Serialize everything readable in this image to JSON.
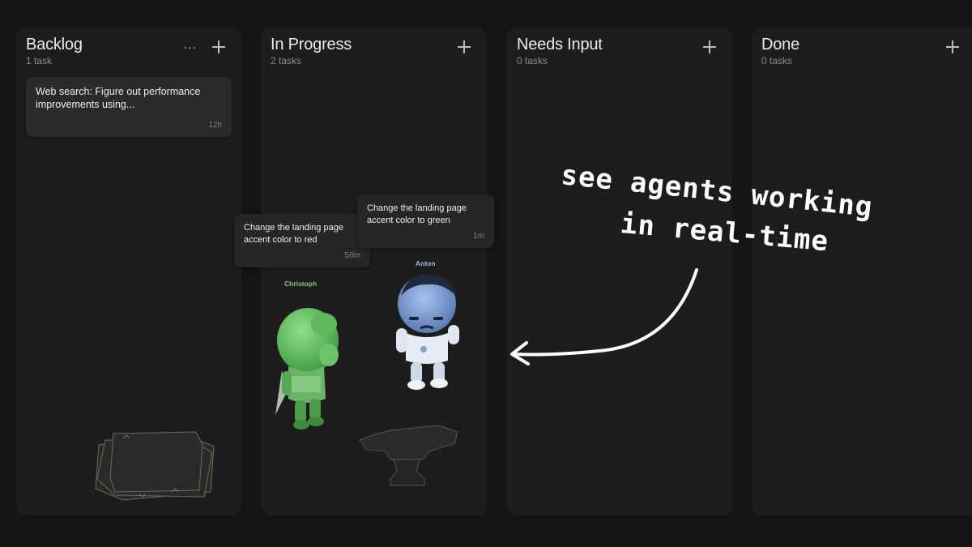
{
  "columns": [
    {
      "title": "Backlog",
      "count": "1 task",
      "more": "..."
    },
    {
      "title": "In Progress",
      "count": "2 tasks"
    },
    {
      "title": "Needs Input",
      "count": "0 tasks"
    },
    {
      "title": "Done",
      "count": "0 tasks"
    }
  ],
  "backlog_card": {
    "text": "Web search: Figure out performance improvements using...",
    "time": "12h"
  },
  "progress_cards": [
    {
      "text": "Change the landing page accent color to red",
      "time": "58m"
    },
    {
      "text": "Change the landing page accent color to green",
      "time": "1m"
    }
  ],
  "agents": [
    {
      "name": "Christoph",
      "color": "#7ec77a"
    },
    {
      "name": "Anton",
      "color": "#9fb7e6"
    }
  ],
  "annotation": {
    "line1": "see agents working",
    "line2": "in real-time"
  }
}
